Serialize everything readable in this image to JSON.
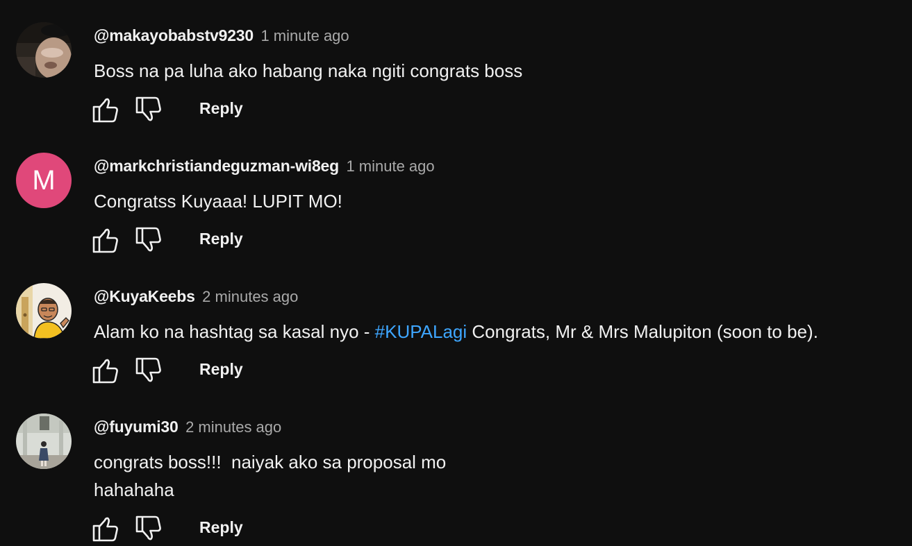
{
  "comments": [
    {
      "author": "@makayobabstv9230",
      "time": "1 minute ago",
      "text": "Boss na pa luha ako habang naka ngiti congrats boss",
      "avatar_type": "photo"
    },
    {
      "author": "@markchristiandeguzman-wi8eg",
      "time": "1 minute ago",
      "text": "Congratss Kuyaaa! LUPIT MO!",
      "avatar_letter": "M",
      "avatar_color": "#e0487a"
    },
    {
      "author": "@KuyaKeebs",
      "time": "2 minutes ago",
      "text_before": "Alam ko na hashtag sa kasal nyo - ",
      "hashtag": "#KUPALagi",
      "text_after": " Congrats, Mr & Mrs Malupiton (soon to be).",
      "avatar_type": "illustration"
    },
    {
      "author": "@fuyumi30",
      "time": "2 minutes ago",
      "text_line1": "congrats boss!!!  naiyak ako sa proposal mo",
      "text_line2": "hahahaha",
      "avatar_type": "photo"
    }
  ],
  "actions": {
    "reply_label": "Reply",
    "like_icon": "thumbs-up-icon",
    "dislike_icon": "thumbs-down-icon"
  },
  "colors": {
    "background": "#0f0f0f",
    "text": "#f1f1f1",
    "secondary_text": "#aaaaaa",
    "hashtag": "#3ea6ff"
  }
}
